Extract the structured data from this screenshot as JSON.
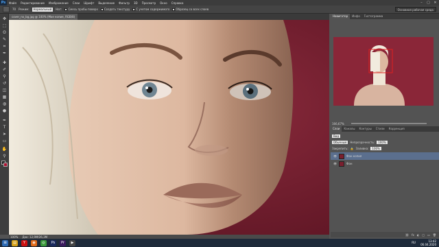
{
  "menubar": {
    "logo": "Ps",
    "items": [
      "Файл",
      "Редактирование",
      "Изображение",
      "Слои",
      "Шрифт",
      "Выделение",
      "Фильтр",
      "3D",
      "Просмотр",
      "Окно",
      "Справка"
    ],
    "controls": [
      "–",
      "▢",
      "✕"
    ]
  },
  "options": {
    "size": "70",
    "mode_label": "Режим:",
    "mode_value": "Нормальный",
    "flow_label": "Нат:",
    "check1": "Смесь пробы поверх",
    "check2": "Создать текстуру",
    "check3": "С учетом содержимого",
    "check4": "Образец со всех слоев",
    "workspace": "Основная рабочая среда"
  },
  "document": {
    "tab": "cover_no_bg.jpg @ 100% (Мое копия, RGB/8)",
    "zoom": "100%",
    "doc_info": "Док: 12,9M/26,3M"
  },
  "navigator": {
    "tabs": [
      "Навигатор",
      "Инфо",
      "Гистограмма"
    ],
    "zoom": "166,67%"
  },
  "layers": {
    "tabs": [
      "Слои",
      "Каналы",
      "Контуры",
      "Стили",
      "Коррекция"
    ],
    "filter": "Вид",
    "blend": "Обычные",
    "opacity_label": "Непрозрачность:",
    "opacity": "100%",
    "lock_label": "Закрепить:",
    "fill_label": "Заливка:",
    "fill": "100%",
    "items": [
      {
        "name": "Фон копия",
        "selected": true
      },
      {
        "name": "Фон",
        "selected": false
      }
    ],
    "icons": [
      "⛓",
      "fx",
      "◐",
      "▢",
      "▭",
      "🗑"
    ]
  },
  "taskbar": {
    "icons": [
      {
        "name": "start-icon",
        "glyph": "⊞",
        "color": "#2d6bb5"
      },
      {
        "name": "explorer-icon",
        "glyph": "▤",
        "color": "#d4a017"
      },
      {
        "name": "yandex-icon",
        "glyph": "Y",
        "color": "#cc1111"
      },
      {
        "name": "firefox-icon",
        "glyph": "◉",
        "color": "#e06a1a"
      },
      {
        "name": "chrome-icon",
        "glyph": "◎",
        "color": "#3a9a3a"
      },
      {
        "name": "photoshop-icon",
        "glyph": "Ps",
        "color": "#1a2a5e"
      },
      {
        "name": "premiere-icon",
        "glyph": "Pr",
        "color": "#3a1a5e"
      },
      {
        "name": "media-icon",
        "glyph": "▶",
        "color": "#444"
      }
    ],
    "time": "13:42",
    "date": "06.04.2020",
    "lang": "RU"
  }
}
